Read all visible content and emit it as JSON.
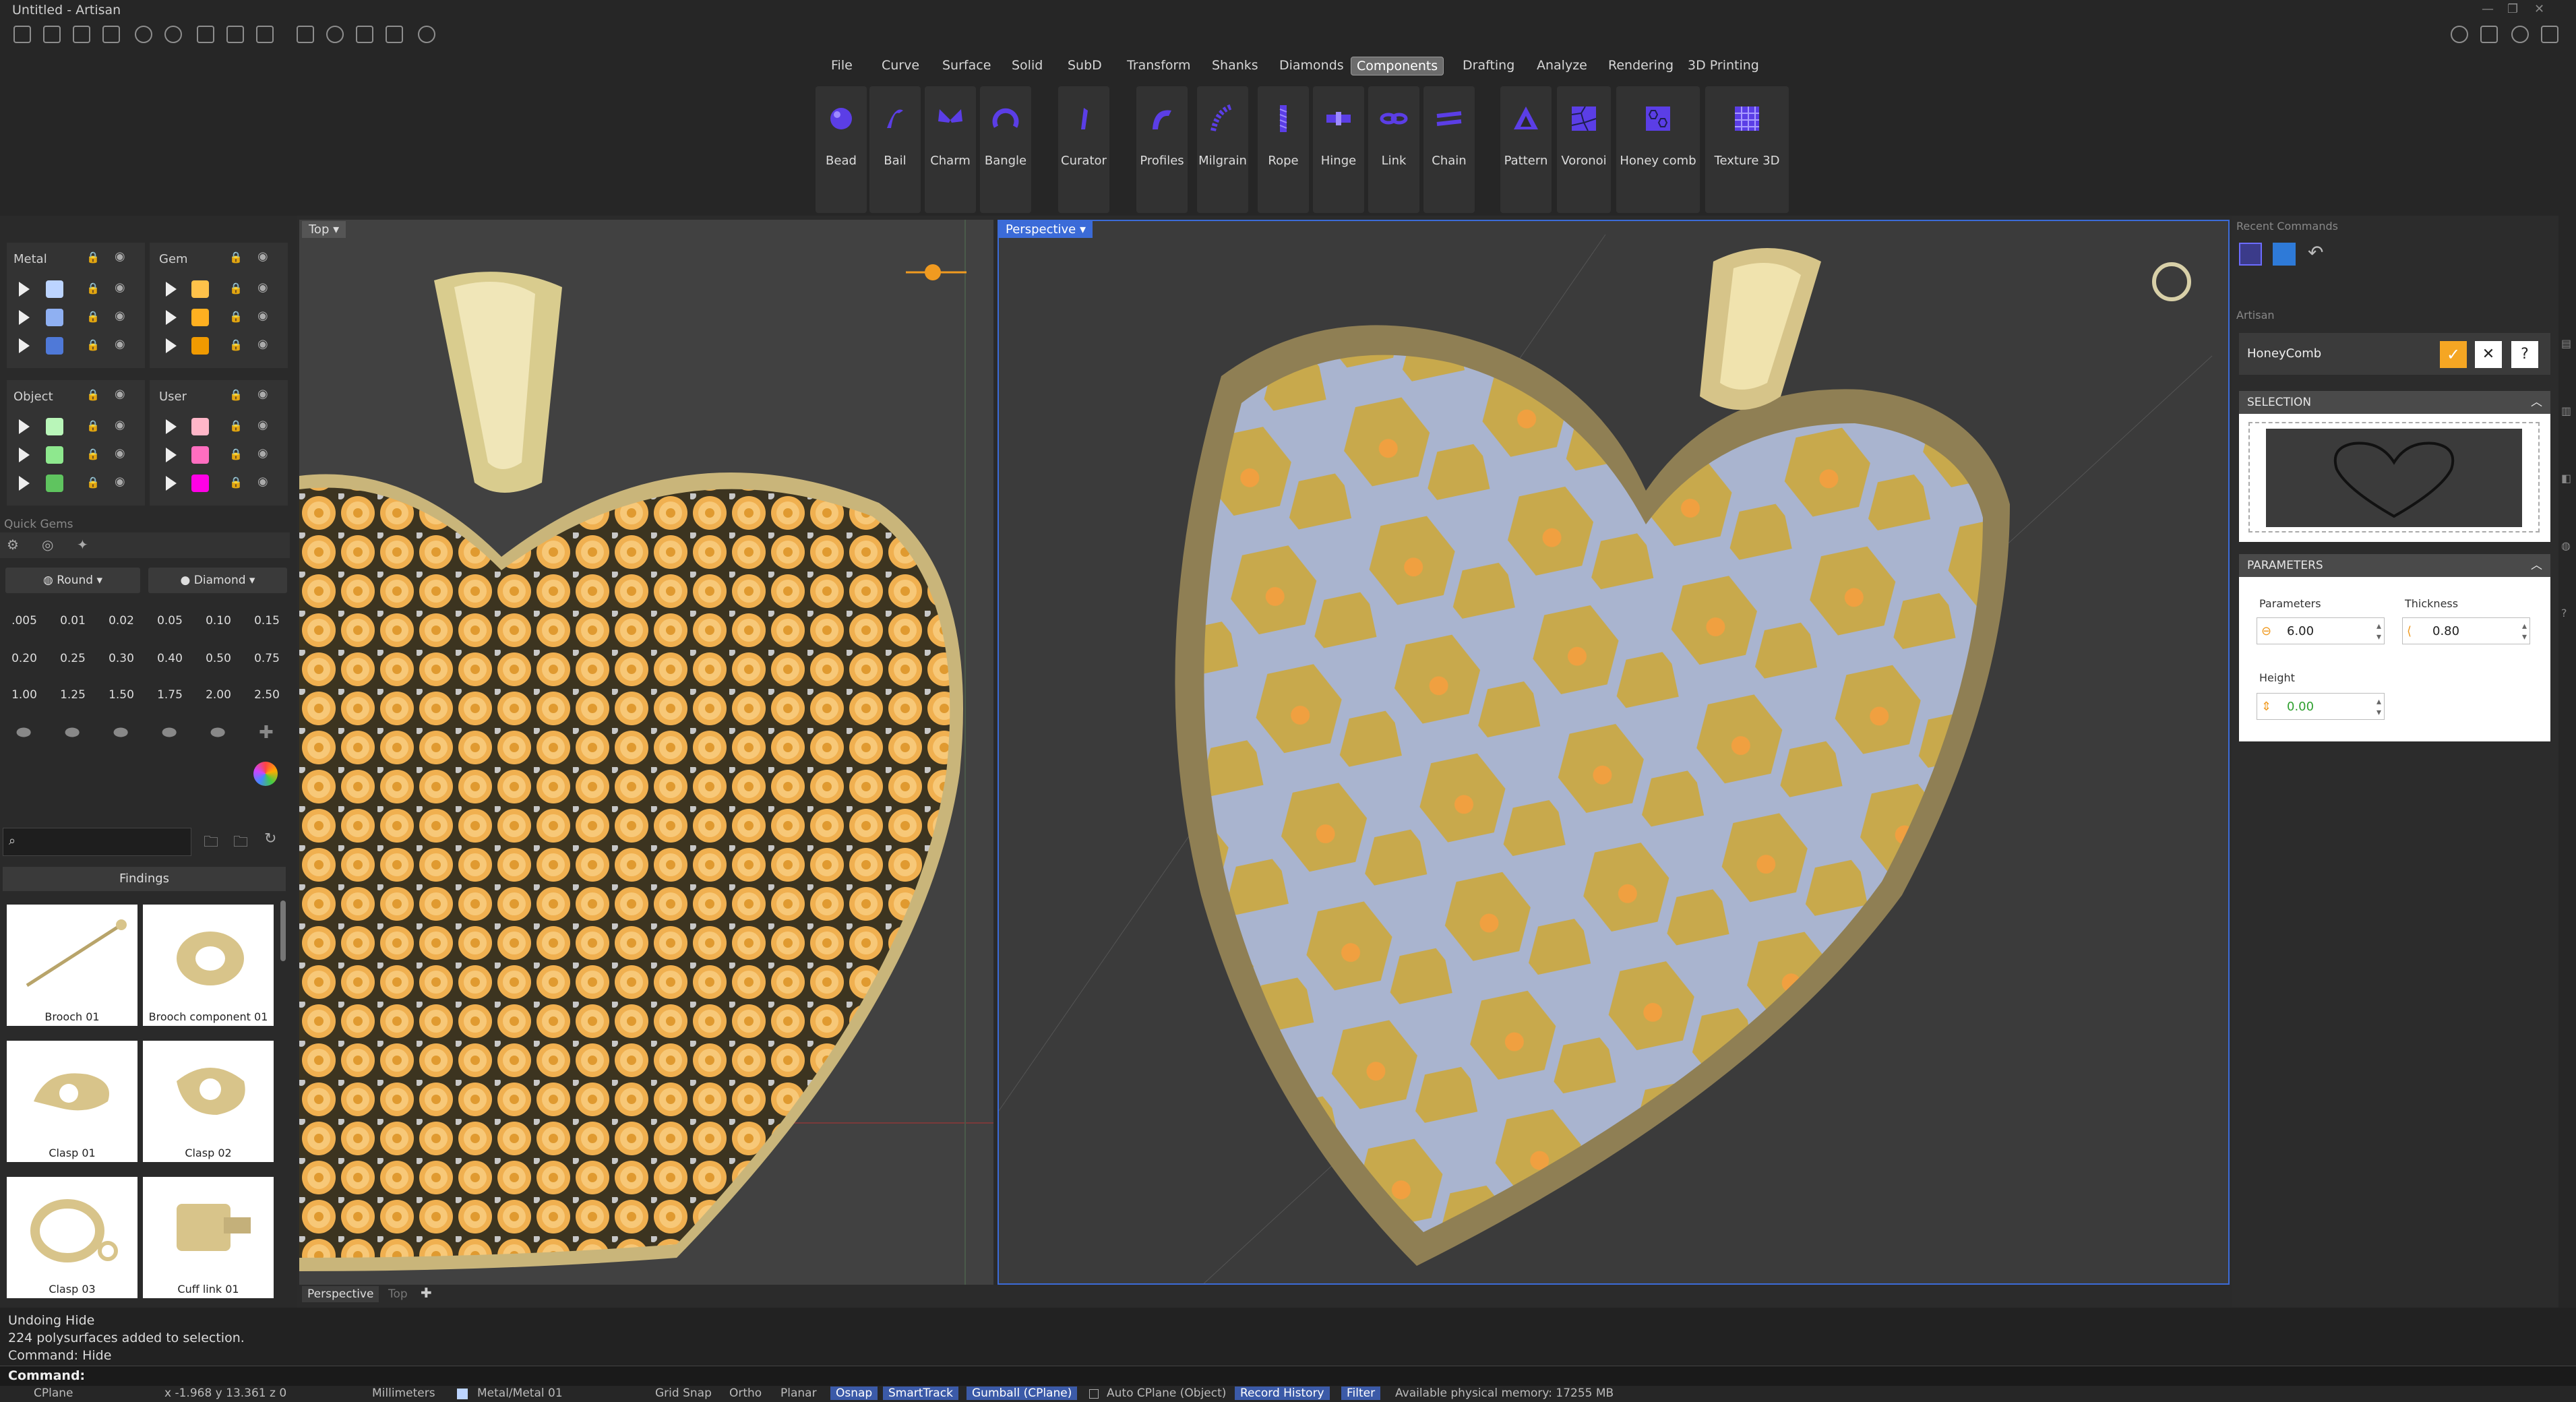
{
  "window": {
    "title": "Untitled - Artisan"
  },
  "menu": {
    "items": [
      "File",
      "Curve",
      "Surface",
      "Solid",
      "SubD",
      "Transform",
      "Shanks",
      "Diamonds",
      "Components",
      "Drafting",
      "Analyze",
      "Rendering",
      "3D Printing"
    ],
    "active": "Components"
  },
  "ribbon": {
    "tools": [
      "Bead",
      "Bail",
      "Charm",
      "Bangle",
      "Curator",
      "Profiles",
      "Milgrain",
      "Rope",
      "Hinge",
      "Link",
      "Chain",
      "Pattern",
      "Voronoi",
      "Honey comb",
      "Texture 3D"
    ]
  },
  "layers": {
    "groups": [
      {
        "name": "Metal",
        "colors": [
          "#bcd4ff",
          "#8fb0f2",
          "#4f79d8"
        ]
      },
      {
        "name": "Gem",
        "colors": [
          "#ffc24a",
          "#ffb020",
          "#f09a00"
        ]
      },
      {
        "name": "Object",
        "colors": [
          "#b9f6b9",
          "#8ee88e",
          "#5fc45f"
        ]
      },
      {
        "name": "User",
        "colors": [
          "#ffb6c8",
          "#ff6ec0",
          "#ff00e6"
        ]
      }
    ]
  },
  "quick_gems": {
    "title": "Quick Gems",
    "shape": "Round",
    "material": "Diamond",
    "sizes": [
      ".005",
      "0.01",
      "0.02",
      "0.05",
      "0.10",
      "0.15",
      "0.20",
      "0.25",
      "0.30",
      "0.40",
      "0.50",
      "0.75",
      "1.00",
      "1.25",
      "1.50",
      "1.75",
      "2.00",
      "2.50"
    ]
  },
  "library": {
    "search_placeholder": "",
    "category": "Findings",
    "items": [
      "Brooch 01",
      "Brooch component 01",
      "Clasp 01",
      "Clasp 02",
      "Clasp 03",
      "Cuff link 01"
    ]
  },
  "viewports": {
    "left": "Top",
    "right": "Perspective",
    "bottom_tabs": [
      "Perspective",
      "Top"
    ]
  },
  "right_panel": {
    "recent_commands_title": "Recent Commands",
    "artisan_title": "Artisan",
    "command_name": "HoneyComb",
    "selection_title": "SELECTION",
    "parameters_title": "PARAMETERS",
    "params": {
      "size_label": "Parameters",
      "size_value": "6.00",
      "thickness_label": "Thickness",
      "thickness_value": "0.80",
      "height_label": "Height",
      "height_value": "0.00"
    }
  },
  "command_history": [
    "Undoing Hide",
    "224 polysurfaces added to selection.",
    "Command: Hide"
  ],
  "command_prompt": "Command:",
  "status": {
    "cplane": "CPlane",
    "coords": "x -1.968  y 13.361  z 0",
    "units": "Millimeters",
    "layer": "Metal/Metal 01",
    "grid_snap": "Grid Snap",
    "ortho": "Ortho",
    "planar": "Planar",
    "osnap": "Osnap",
    "smarttrack": "SmartTrack",
    "gumball": "Gumball (CPlane)",
    "auto_cplane": "Auto CPlane (Object)",
    "record_history": "Record History",
    "filter": "Filter",
    "memory": "Available physical memory: 17255 MB"
  },
  "colors": {
    "accent": "#6d6d6d",
    "gold": "#e8c97a",
    "honeycomb": "#aab4cc",
    "confirm": "#f5a623"
  }
}
